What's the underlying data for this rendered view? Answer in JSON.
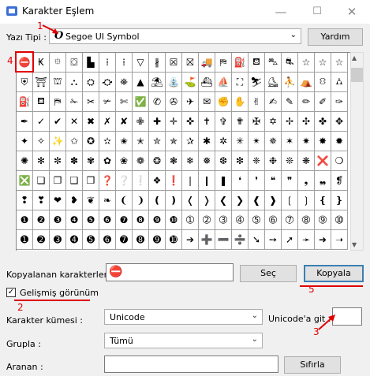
{
  "window": {
    "title": "Karakter Eşlem",
    "minimize": "—",
    "maximize": "☐",
    "close": "✕"
  },
  "font_row": {
    "label": "Yazı Tipi :",
    "font_icon": "O",
    "font_value": "Segoe UI Symbol",
    "help_label": "Yardım"
  },
  "grid_rows": [
    [
      "⛔",
      "₭",
      "⯐",
      "⛋",
      "▙",
      "⁞",
      "⁞",
      "▽",
      "∦",
      "☒",
      "⛝",
      "🚚",
      "⛿",
      "⛽",
      "⛾",
      "⛍",
      "⛐",
      "☆",
      "☆",
      "☆"
    ],
    [
      "⛨",
      "⛩",
      "⛫",
      "⛬",
      "⛭",
      "⛮",
      "⛯",
      "▲",
      "⛱",
      "⛲",
      "⛳",
      "⛴",
      "⛵",
      "⛶",
      "⛷",
      "⛸",
      "⛹",
      "⛺",
      "⛻",
      "⛼"
    ],
    [
      "⛽",
      "⛾",
      "⛿",
      "✁",
      "✂",
      "✃",
      "✄",
      "✅",
      "✆",
      "✇",
      "✈",
      "✉",
      "✊",
      "✋",
      "✌",
      "✍",
      "✎",
      "✏",
      "✐",
      "✑"
    ],
    [
      "✒",
      "✓",
      "✔",
      "✕",
      "✖",
      "✗",
      "✘",
      "✙",
      "✚",
      "✛",
      "✜",
      "✝",
      "✞",
      "✟",
      "✠",
      "✡",
      "✢",
      "✣",
      "✤",
      "✥"
    ],
    [
      "✦",
      "✧",
      "✨",
      "✩",
      "✪",
      "✫",
      "✬",
      "✭",
      "✮",
      "✯",
      "✰",
      "✱",
      "✲",
      "✳",
      "✴",
      "✵",
      "✶",
      "✷",
      "✸",
      "✹"
    ],
    [
      "✺",
      "✻",
      "✼",
      "✽",
      "✾",
      "✿",
      "❀",
      "❁",
      "❂",
      "❃",
      "❄",
      "❅",
      "❆",
      "❇",
      "❈",
      "❉",
      "❊",
      "❋",
      "❌",
      "❍"
    ],
    [
      "❎",
      "❏",
      "❐",
      "❑",
      "❒",
      "❓",
      "❔",
      "❕",
      "❖",
      "❗",
      "❘",
      "❙",
      "❚",
      "❛",
      "❜",
      "❝",
      "❞",
      "❟",
      "❠",
      "❡"
    ],
    [
      "❢",
      "❣",
      "❤",
      "❥",
      "❦",
      "❧",
      "❨",
      "❩",
      "❪",
      "❫",
      "❬",
      "❭",
      "❮",
      "❯",
      "❰",
      "❱",
      "❲",
      "❳",
      "❴",
      "❵"
    ],
    [
      "❶",
      "❷",
      "❸",
      "❹",
      "❺",
      "❻",
      "❼",
      "❽",
      "❾",
      "❿",
      "➀",
      "➁",
      "➂",
      "➃",
      "➄",
      "➅",
      "➆",
      "➇",
      "➈",
      "➉"
    ],
    [
      "➊",
      "➋",
      "➌",
      "➍",
      "➎",
      "➏",
      "➐",
      "➑",
      "➒",
      "➓",
      "➔",
      "➕",
      "➖",
      "➗",
      "➘",
      "➙",
      "➚",
      "➛",
      "➜",
      "➝"
    ]
  ],
  "copy_row": {
    "label": "Kopyalanan karakterler :",
    "copied_value": "⛔",
    "select_label": "Seç",
    "copy_label": "Kopyala"
  },
  "advanced": {
    "label": "Gelişmiş görünüm",
    "checked": true
  },
  "charset": {
    "label": "Karakter kümesi :",
    "value": "Unicode"
  },
  "goto": {
    "label": "Unicode'a git :",
    "value": ""
  },
  "group": {
    "label": "Grupla :",
    "value": "Tümü"
  },
  "search": {
    "label": "Aranan :",
    "value": "",
    "reset_label": "Sıfırla"
  },
  "annotations": {
    "n1": "1",
    "n2": "2",
    "n3": "3",
    "n4": "4",
    "n5": "5"
  },
  "colors": {
    "annotation": "#e00000",
    "focus": "#3c7fb1"
  }
}
